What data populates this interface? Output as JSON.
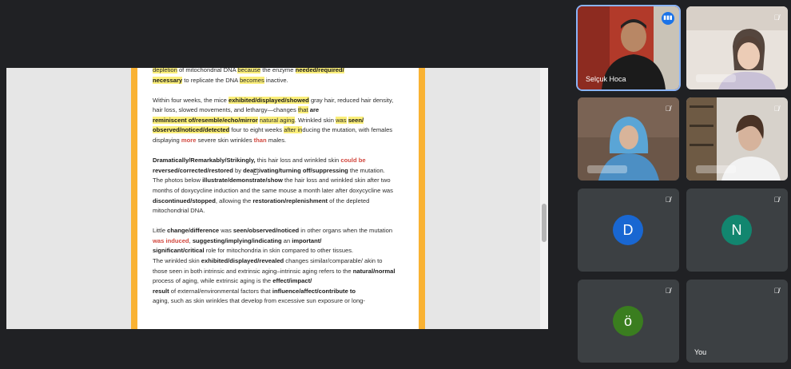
{
  "document": {
    "paragraphs": [
      [
        {
          "t": "depletion",
          "c": "hl"
        },
        {
          "t": " of mitochondrial DNA "
        },
        {
          "t": "because",
          "c": "hl"
        },
        {
          "t": " the enzyme "
        },
        {
          "t": "needed/required/",
          "c": "bhl"
        },
        {
          "t": "\n"
        },
        {
          "t": "necessary",
          "c": "bhl"
        },
        {
          "t": " to replicate the DNA "
        },
        {
          "t": "becomes",
          "c": "hl"
        },
        {
          "t": " inactive."
        }
      ],
      [
        {
          "t": "Within four weeks, the mice "
        },
        {
          "t": "exhibited/displayed/showed",
          "c": "bhl"
        },
        {
          "t": " gray hair, reduced hair density, hair loss, slowed movements, and lethargy—changes "
        },
        {
          "t": "that",
          "c": "hl"
        },
        {
          "t": " "
        },
        {
          "t": "are",
          "c": "b"
        },
        {
          "t": "\n"
        },
        {
          "t": "reminiscent of/resemble/echo/mirror",
          "c": "bhl"
        },
        {
          "t": " "
        },
        {
          "t": "natural aging",
          "c": "hl"
        },
        {
          "t": ". Wrinkled skin "
        },
        {
          "t": "was",
          "c": "hl"
        },
        {
          "t": " "
        },
        {
          "t": "seen/",
          "c": "bhl"
        },
        {
          "t": "\n"
        },
        {
          "t": "observed/noticed/detected",
          "c": "bhl"
        },
        {
          "t": " four to eight weeks "
        },
        {
          "t": "after in",
          "c": "hl"
        },
        {
          "t": "ducing the mutation, with females displaying "
        },
        {
          "t": "more",
          "c": "red"
        },
        {
          "t": " severe skin wrinkles "
        },
        {
          "t": "than",
          "c": "red"
        },
        {
          "t": " males."
        }
      ],
      [
        {
          "t": "Dramatically/Remarkably/Strikingly,",
          "c": "b"
        },
        {
          "t": " this hair loss and wrinkled skin "
        },
        {
          "t": "could be",
          "c": "red"
        },
        {
          "t": "\n"
        },
        {
          "t": "reversed/corrected/restored",
          "c": "b"
        },
        {
          "t": " by "
        },
        {
          "t": "deactivating/turning off/suppressing",
          "c": "b"
        },
        {
          "t": " the mutation. The photos below "
        },
        {
          "t": "illustrate/demonstrate/show",
          "c": "b"
        },
        {
          "t": " the hair loss and wrinkled skin after two months of doxycycline induction and the same mouse a month later after doxycycline was "
        },
        {
          "t": "discontinued/stopped",
          "c": "b"
        },
        {
          "t": ", allowing the "
        },
        {
          "t": "restoration/replenishment",
          "c": "b"
        },
        {
          "t": " of the depleted mitochondrial DNA."
        }
      ],
      [
        {
          "t": "Little "
        },
        {
          "t": "change/difference",
          "c": "b"
        },
        {
          "t": " was "
        },
        {
          "t": "seen/observed/noticed",
          "c": "b"
        },
        {
          "t": " in other organs when the mutation "
        },
        {
          "t": "was induced",
          "c": "red"
        },
        {
          "t": ", "
        },
        {
          "t": "suggesting/implying/indicating",
          "c": "b"
        },
        {
          "t": " an "
        },
        {
          "t": "important/",
          "c": "b"
        },
        {
          "t": "\n"
        },
        {
          "t": "significant/critical",
          "c": "b"
        },
        {
          "t": " role for mitochondria in skin compared to other tissues.\nThe wrinkled skin "
        },
        {
          "t": "exhibited/displayed/revealed",
          "c": "b"
        },
        {
          "t": " changes similar/comparable/ akin to those seen in both intrinsic and extrinsic aging–intrinsic aging refers to the "
        },
        {
          "t": "natural/normal",
          "c": "b"
        },
        {
          "t": " process of aging, while extrinsic aging is the "
        },
        {
          "t": "effect/impact/",
          "c": "b"
        },
        {
          "t": "\n"
        },
        {
          "t": "result",
          "c": "b"
        },
        {
          "t": " of external/environmental factors that "
        },
        {
          "t": "influence/affect/contribute to",
          "c": "b"
        },
        {
          "t": "\naging, such as skin wrinkles that develop from excessive sun exposure or long-"
        }
      ]
    ]
  },
  "side_toolbar": {
    "icons": [
      "keep-icon",
      "tasks-icon",
      "contacts-icon",
      "maps-icon",
      "calendar-icon",
      "edit-icon",
      "bookmark-icon",
      "tree-icon",
      "plus-icon",
      "panel-icon",
      "settings-icon"
    ],
    "plus_label": "+"
  },
  "participants": [
    {
      "name": "Selçuk Hoca",
      "speaking": true,
      "muted": false,
      "type": "video"
    },
    {
      "name": "",
      "muted": true,
      "type": "video"
    },
    {
      "name": "",
      "muted": true,
      "type": "video"
    },
    {
      "name": "",
      "muted": true,
      "type": "video"
    },
    {
      "initial": "D",
      "name": "",
      "muted": true,
      "type": "avatar",
      "color": "#1967d2"
    },
    {
      "initial": "N",
      "name": "",
      "muted": true,
      "type": "avatar",
      "color": "#12866f"
    },
    {
      "initial": "ö",
      "name": "",
      "muted": true,
      "type": "avatar",
      "color": "#3a7d1f"
    },
    {
      "name": "You",
      "muted": true,
      "type": "self"
    }
  ]
}
